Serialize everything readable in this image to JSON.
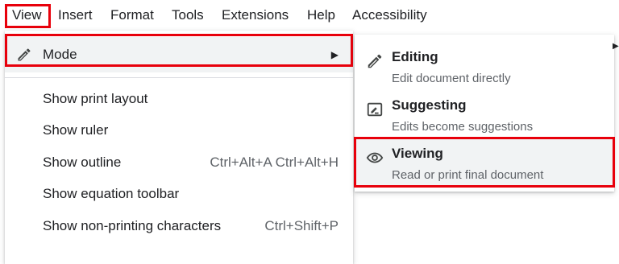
{
  "menubar": {
    "items": [
      "View",
      "Insert",
      "Format",
      "Tools",
      "Extensions",
      "Help",
      "Accessibility"
    ]
  },
  "view_menu": {
    "mode_label": "Mode",
    "items": [
      {
        "label": "Show print layout",
        "shortcut": ""
      },
      {
        "label": "Show ruler",
        "shortcut": ""
      },
      {
        "label": "Show outline",
        "shortcut": "Ctrl+Alt+A Ctrl+Alt+H"
      },
      {
        "label": "Show equation toolbar",
        "shortcut": ""
      },
      {
        "label": "Show non-printing characters",
        "shortcut": "Ctrl+Shift+P"
      }
    ]
  },
  "mode_submenu": {
    "items": [
      {
        "title": "Editing",
        "description": "Edit document directly",
        "icon": "pencil-icon"
      },
      {
        "title": "Suggesting",
        "description": "Edits become suggestions",
        "icon": "suggest-icon"
      },
      {
        "title": "Viewing",
        "description": "Read or print final document",
        "icon": "eye-icon"
      }
    ],
    "active_index": 2
  },
  "colors": {
    "highlight": "#e8000b",
    "hover": "#f1f3f4",
    "text": "#202124",
    "secondary": "#5f6368"
  }
}
